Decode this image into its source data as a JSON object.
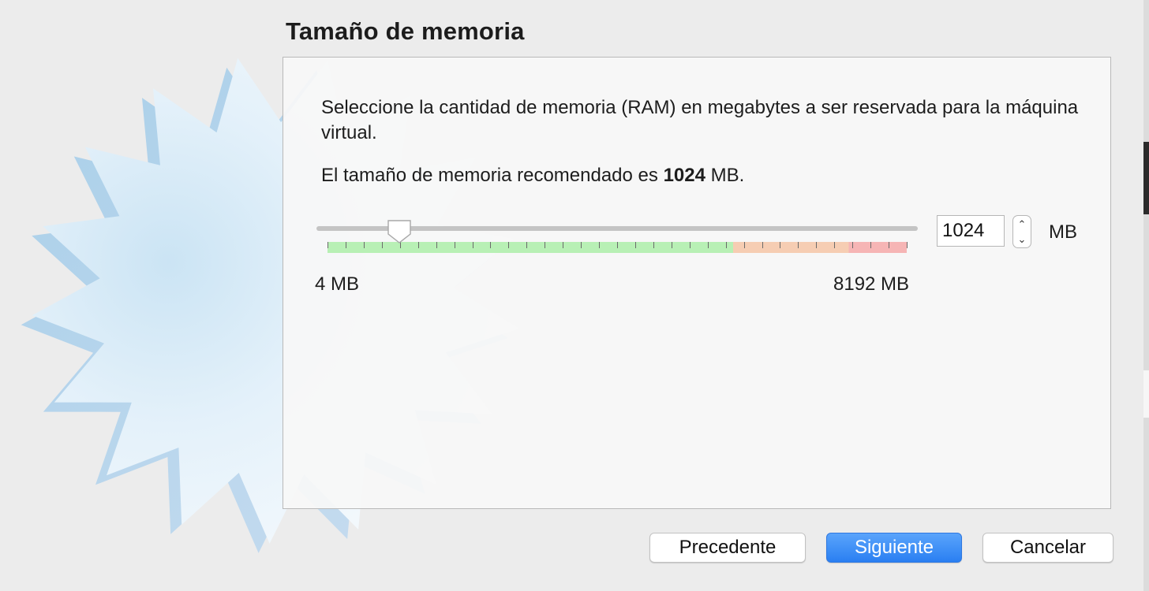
{
  "page": {
    "title": "Tamaño de memoria"
  },
  "content": {
    "description": "Seleccione la cantidad de memoria (RAM) en megabytes a ser reservada para la máquina virtual.",
    "recommended_prefix": "El tamaño de memoria recomendado es ",
    "recommended_value": "1024",
    "recommended_suffix": " MB."
  },
  "memory_slider": {
    "min_label": "4 MB",
    "max_label": "8192 MB",
    "min_mb": 4,
    "max_mb": 8192,
    "value_mb": 1024,
    "ranges": [
      {
        "level": "ok",
        "color": "#b8f0b5"
      },
      {
        "level": "warning",
        "color": "#f6cdb3"
      },
      {
        "level": "danger",
        "color": "#f6b5b5"
      }
    ]
  },
  "memory_input": {
    "value": "1024",
    "unit": "MB",
    "stepper_up_icon": "chevron-up-icon",
    "stepper_down_icon": "chevron-down-icon"
  },
  "buttons": {
    "back_label": "Precedente",
    "next_label": "Siguiente",
    "cancel_label": "Cancelar"
  },
  "colors": {
    "accent": "#2a7ff2",
    "background": "#ececec"
  },
  "decoration": {
    "watermark_icon": "starburst-icon"
  }
}
